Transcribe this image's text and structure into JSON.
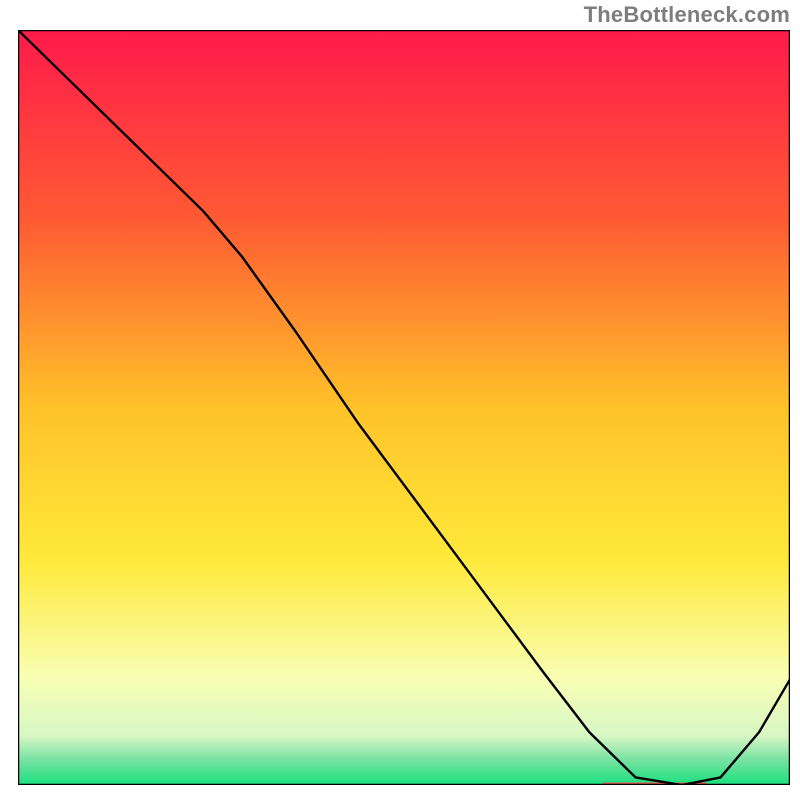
{
  "watermark": "TheBottleneck.com",
  "chart_data": {
    "type": "line",
    "title": "",
    "xlabel": "",
    "ylabel": "",
    "xlim": [
      0,
      100
    ],
    "ylim": [
      0,
      100
    ],
    "axes_visible": false,
    "grid": false,
    "background_gradient": {
      "stops": [
        {
          "offset": 0.0,
          "color": "#ff1a4b"
        },
        {
          "offset": 0.25,
          "color": "#ff5a33"
        },
        {
          "offset": 0.5,
          "color": "#ffc229"
        },
        {
          "offset": 0.7,
          "color": "#ffe93a"
        },
        {
          "offset": 0.86,
          "color": "#f8ffb4"
        },
        {
          "offset": 0.935,
          "color": "#d7f7c4"
        },
        {
          "offset": 0.965,
          "color": "#7de2a4"
        },
        {
          "offset": 1.0,
          "color": "#19e07e"
        }
      ]
    },
    "series": [
      {
        "name": "curve",
        "color": "#000000",
        "width": 2.4,
        "x": [
          0,
          6,
          16,
          24,
          29,
          36,
          44,
          52,
          60,
          68,
          74,
          80,
          86,
          91,
          96,
          100
        ],
        "y": [
          100,
          94,
          84,
          76,
          70,
          60,
          48,
          37,
          26,
          15,
          7,
          1,
          0,
          1,
          7,
          14
        ]
      }
    ],
    "highlight_segment": {
      "color": "#e4574f",
      "thickness": 5,
      "x_range": [
        76,
        89
      ],
      "y": 0
    }
  }
}
